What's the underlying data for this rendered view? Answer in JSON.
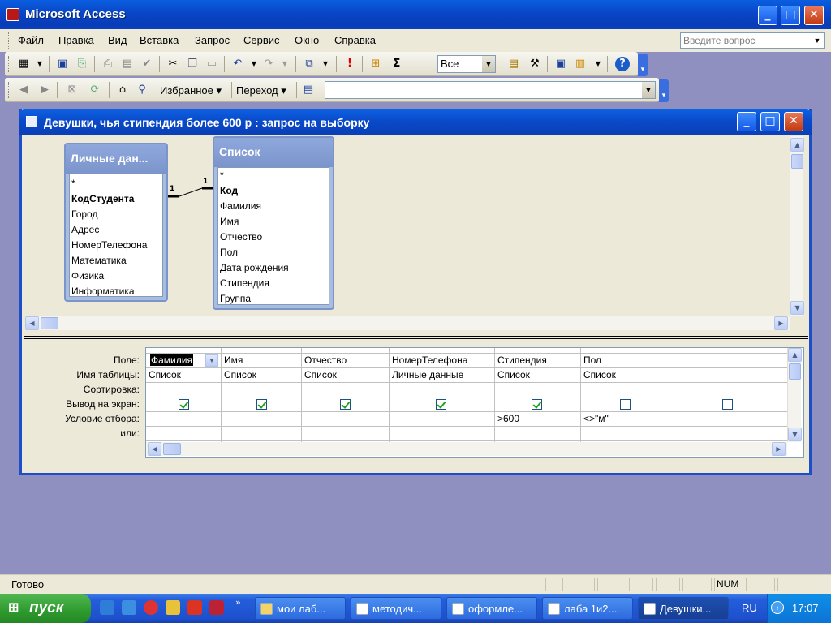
{
  "app": {
    "title": "Microsoft Access",
    "window_buttons": [
      "_",
      "□",
      "✕"
    ]
  },
  "menu": {
    "items": [
      "Файл",
      "Правка",
      "Вид",
      "Вставка",
      "Запрос",
      "Сервис",
      "Окно",
      "Справка"
    ],
    "ask_placeholder": "Введите вопрос"
  },
  "toolbar": {
    "top_values": "Все",
    "favorites_label": "Избранное",
    "goto_label": "Переход",
    "address_value": ""
  },
  "query_window": {
    "title": "Девушки, чья стипендия более 600 р : запрос на выборку"
  },
  "tables": [
    {
      "name": "Личные дан...",
      "fields": [
        "*",
        "КодСтудента",
        "Город",
        "Адрес",
        "НомерТелефона",
        "Математика",
        "Физика",
        "Информатика"
      ],
      "key_field": "КодСтудента"
    },
    {
      "name": "Список",
      "fields": [
        "*",
        "Код",
        "Фамилия",
        "Имя",
        "Отчество",
        "Пол",
        "Дата рождения",
        "Стипендия",
        "Группа"
      ],
      "key_field": "Код"
    }
  ],
  "relation": {
    "left_label": "1",
    "right_label": "1"
  },
  "grid": {
    "row_labels": [
      "Поле:",
      "Имя таблицы:",
      "Сортировка:",
      "Вывод на экран:",
      "Условие отбора:",
      "или:"
    ],
    "columns": [
      {
        "field": "Фамилия",
        "table": "Список",
        "sort": "",
        "show": true,
        "criteria": "",
        "or": ""
      },
      {
        "field": "Имя",
        "table": "Список",
        "sort": "",
        "show": true,
        "criteria": "",
        "or": ""
      },
      {
        "field": "Отчество",
        "table": "Список",
        "sort": "",
        "show": true,
        "criteria": "",
        "or": ""
      },
      {
        "field": "НомерТелефона",
        "table": "Личные данные",
        "sort": "",
        "show": true,
        "criteria": "",
        "or": ""
      },
      {
        "field": "Стипендия",
        "table": "Список",
        "sort": "",
        "show": true,
        "criteria": ">600",
        "or": ""
      },
      {
        "field": "Пол",
        "table": "Список",
        "sort": "",
        "show": false,
        "criteria": "<>\"м\"",
        "or": ""
      },
      {
        "field": "",
        "table": "",
        "sort": "",
        "show": false,
        "criteria": "",
        "or": ""
      }
    ]
  },
  "status": {
    "text": "Готово",
    "num": "NUM"
  },
  "taskbar": {
    "start": "пуск",
    "tasks": [
      "мои лаб...",
      "методич...",
      "оформле...",
      "лаба 1и2...",
      "Девушки..."
    ],
    "lang": "RU",
    "time": "17:07"
  }
}
